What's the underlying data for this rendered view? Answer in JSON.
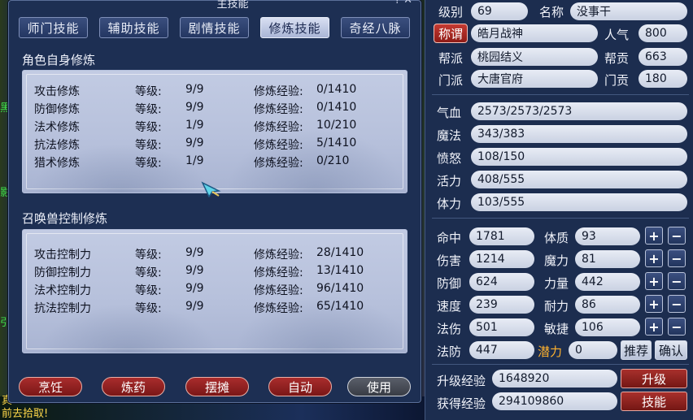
{
  "window": {
    "title": "主技能",
    "tabs": [
      "师门技能",
      "辅助技能",
      "剧情技能",
      "修炼技能",
      "奇经八脉"
    ],
    "active_tab": 3,
    "self_section_title": "角色自身修炼",
    "pet_section_title": "召唤兽控制修炼",
    "col_level": "等级:",
    "col_exp": "修炼经验:",
    "self_rows": [
      {
        "name": "攻击修炼",
        "level": "9/9",
        "exp": "0/1410"
      },
      {
        "name": "防御修炼",
        "level": "9/9",
        "exp": "0/1410"
      },
      {
        "name": "法术修炼",
        "level": "1/9",
        "exp": "10/210"
      },
      {
        "name": "抗法修炼",
        "level": "9/9",
        "exp": "5/1410"
      },
      {
        "name": "猎术修炼",
        "level": "1/9",
        "exp": "0/210"
      }
    ],
    "pet_rows": [
      {
        "name": "攻击控制力",
        "level": "9/9",
        "exp": "28/1410"
      },
      {
        "name": "防御控制力",
        "level": "9/9",
        "exp": "13/1410"
      },
      {
        "name": "法术控制力",
        "level": "9/9",
        "exp": "96/1410"
      },
      {
        "name": "抗法控制力",
        "level": "9/9",
        "exp": "65/1410"
      }
    ],
    "buttons": [
      "烹饪",
      "炼药",
      "摆摊",
      "自动",
      "使用"
    ]
  },
  "left_fragments": [
    "黑",
    "影",
    "引"
  ],
  "bottom_text": "前去拾取!",
  "bottom_text2": "真",
  "attributes": {
    "level_label": "级别",
    "level": "69",
    "name_label": "名称",
    "name": "没事干",
    "title_label": "称谓",
    "title": "皓月战神",
    "popularity_label": "人气",
    "popularity": "800",
    "gang_label": "帮派",
    "gang": "桃园结义",
    "gang_contrib_label": "帮贡",
    "gang_contrib": "663",
    "school_label": "门派",
    "school": "大唐官府",
    "school_contrib_label": "门贡",
    "school_contrib": "180",
    "hp_label": "气血",
    "hp": "2573/2573/2573",
    "mp_label": "魔法",
    "mp": "343/383",
    "anger_label": "愤怒",
    "anger": "108/150",
    "vitality_label": "活力",
    "vitality": "408/555",
    "stamina_label": "体力",
    "stamina": "103/555",
    "stats_left": [
      {
        "label": "命中",
        "value": "1781"
      },
      {
        "label": "伤害",
        "value": "1214"
      },
      {
        "label": "防御",
        "value": "624"
      },
      {
        "label": "速度",
        "value": "239"
      },
      {
        "label": "法伤",
        "value": "501"
      },
      {
        "label": "法防",
        "value": "447"
      }
    ],
    "stats_right": [
      {
        "label": "体质",
        "value": "93"
      },
      {
        "label": "魔力",
        "value": "81"
      },
      {
        "label": "力量",
        "value": "442"
      },
      {
        "label": "耐力",
        "value": "86"
      },
      {
        "label": "敏捷",
        "value": "106"
      }
    ],
    "potential_label": "潜力",
    "potential": "0",
    "recommend_label": "推荐",
    "confirm_label": "确认",
    "plus": "+",
    "minus": "−",
    "upgrade_exp_label": "升级经验",
    "upgrade_exp": "1648920",
    "gained_exp_label": "获得经验",
    "gained_exp": "294109860",
    "upgrade_button": "升级",
    "skills_button": "技能"
  }
}
